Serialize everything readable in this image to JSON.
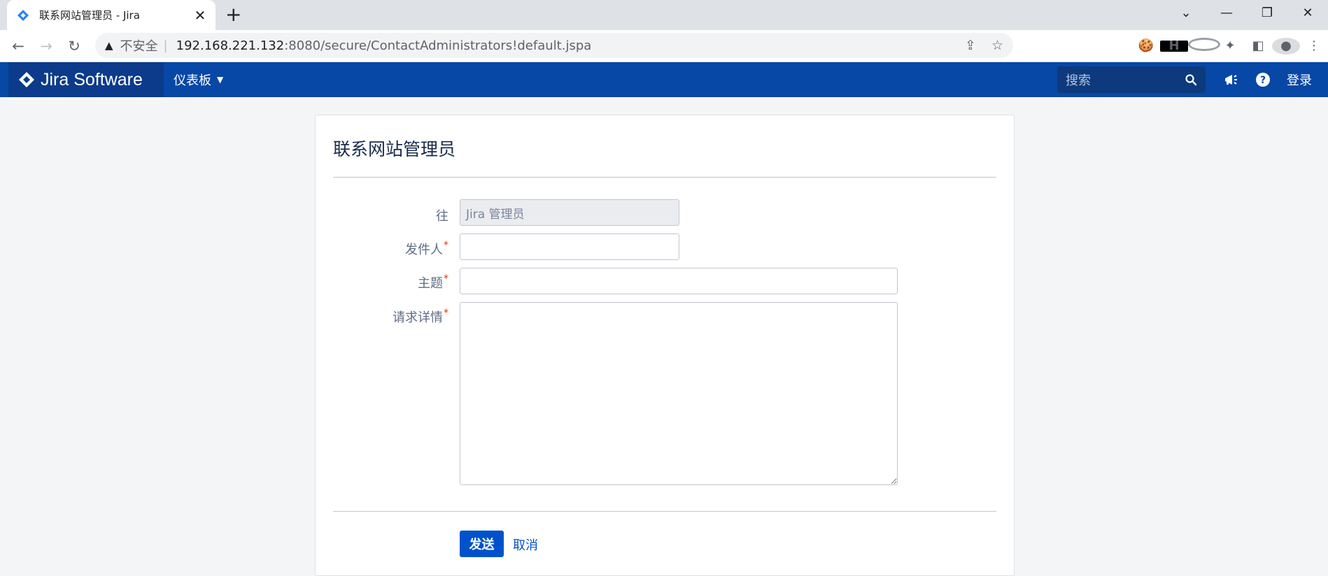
{
  "browser": {
    "tab_title": "联系网站管理员 - Jira",
    "tab_close": "✕",
    "new_tab": "+",
    "address": {
      "insecure_label": "不安全",
      "separator": "|",
      "host": "192.168.221.132",
      "path": ":8080/secure/ContactAdministrators!default.jspa"
    },
    "window_controls": [
      "⌄",
      "—",
      "❐",
      "✕"
    ]
  },
  "header": {
    "logo_text": "Jira Software",
    "menu_dashboard": "仪表板",
    "search_placeholder": "搜索",
    "login": "登录",
    "brand_color": "#0747a6"
  },
  "form": {
    "title": "联系网站管理员",
    "to_label": "往",
    "to_value": "Jira 管理员",
    "from_label": "发件人",
    "subject_label": "主题",
    "details_label": "请求详情",
    "required_mark": "*",
    "send_label": "发送",
    "cancel_label": "取消"
  }
}
